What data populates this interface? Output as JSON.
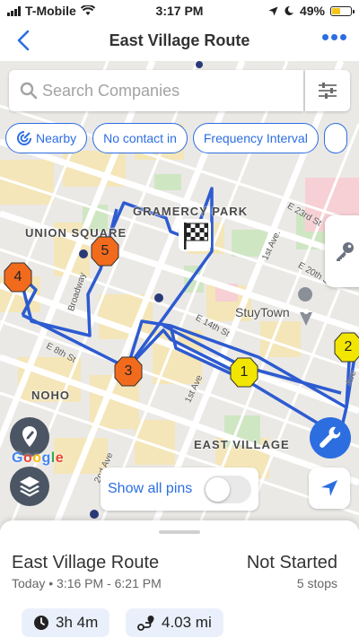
{
  "status_bar": {
    "carrier": "T-Mobile",
    "time": "3:17 PM",
    "battery": "49%",
    "battery_level": 0.49
  },
  "nav": {
    "title": "East Village Route"
  },
  "search": {
    "placeholder": "Search Companies"
  },
  "filters": [
    {
      "label": "Nearby"
    },
    {
      "label": "No contact in"
    },
    {
      "label": "Frequency Interval"
    }
  ],
  "map": {
    "neighborhood_labels": [
      "GRAMERCY PARK",
      "UNION SQUARE",
      "NOHO",
      "EAST VILLAGE",
      "StuyTown"
    ],
    "street_labels": [
      "E 23rd St",
      "E 20th St",
      "E 14th St",
      "E 8th St",
      "1st Ave.",
      "1st Ave",
      "2nd Ave",
      "Broadway",
      "Ave"
    ],
    "stops": [
      {
        "label": "1",
        "status": "pending",
        "color": "#f2e600"
      },
      {
        "label": "2",
        "status": "pending",
        "color": "#f2e600"
      },
      {
        "label": "3",
        "status": "overdue",
        "color": "#f26b1d"
      },
      {
        "label": "4",
        "status": "overdue",
        "color": "#f26b1d"
      },
      {
        "label": "5",
        "status": "overdue",
        "color": "#f26b1d"
      }
    ],
    "route_color": "#2d5bd0",
    "attribution": "Google",
    "show_all_pins_label": "Show all pins",
    "show_all_pins_on": false
  },
  "route": {
    "name": "East Village Route",
    "time": "Today • 3:16 PM - 6:21 PM",
    "status": "Not Started",
    "stops": "5 stops",
    "duration": "3h 4m",
    "distance": "4.03 mi"
  },
  "colors": {
    "accent": "#2c6ee0",
    "button_dark": "#4b5563"
  }
}
